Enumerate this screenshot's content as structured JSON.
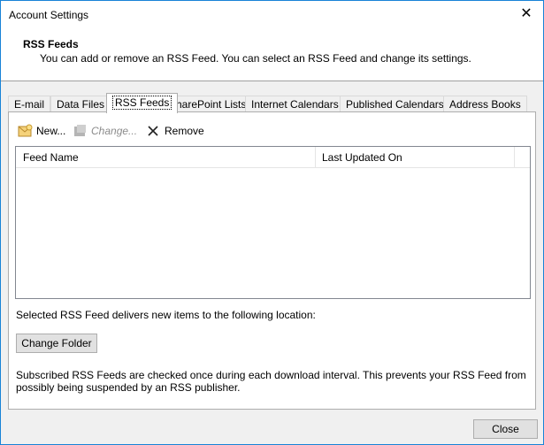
{
  "window": {
    "title": "Account Settings"
  },
  "header": {
    "title": "RSS Feeds",
    "description": "You can add or remove an RSS Feed. You can select an RSS Feed and change its settings."
  },
  "tabs": [
    {
      "label": "E-mail"
    },
    {
      "label": "Data Files"
    },
    {
      "label": "RSS Feeds",
      "active": true
    },
    {
      "label": "SharePoint Lists"
    },
    {
      "label": "Internet Calendars"
    },
    {
      "label": "Published Calendars"
    },
    {
      "label": "Address Books"
    }
  ],
  "toolbar": {
    "new_label": "New...",
    "change_label": "Change...",
    "remove_label": "Remove"
  },
  "list": {
    "columns": [
      "Feed Name",
      "Last Updated On"
    ],
    "rows": []
  },
  "location_text": "Selected RSS Feed delivers new items to the following location:",
  "change_folder_label": "Change Folder",
  "info_text": "Subscribed RSS Feeds are checked once during each download interval. This prevents your RSS Feed from possibly being suspended by an RSS publisher.",
  "close_label": "Close",
  "colors": {
    "accent_border": "#1883d7",
    "disabled_text": "#8c8c8c"
  },
  "icons": {
    "new": "new-feed-icon",
    "change": "change-icon",
    "remove": "remove-x-icon",
    "window_close": "close-icon"
  }
}
